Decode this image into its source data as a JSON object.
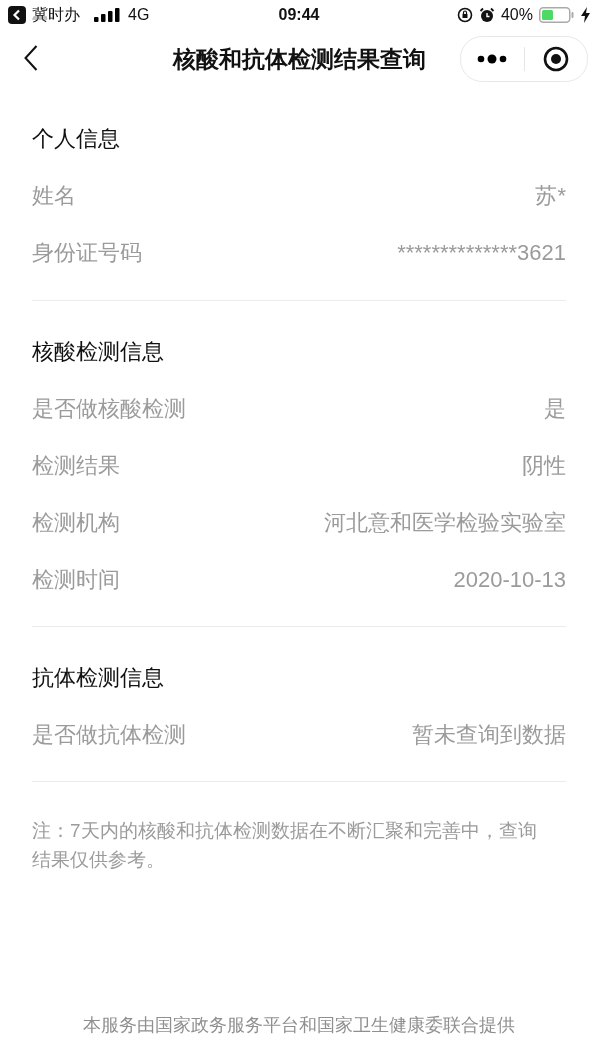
{
  "status_bar": {
    "back_app": "冀时办",
    "network": "4G",
    "time": "09:44",
    "battery": "40%"
  },
  "nav": {
    "title": "核酸和抗体检测结果查询"
  },
  "sections": [
    {
      "title": "个人信息",
      "rows": [
        {
          "label": "姓名",
          "value": "苏*"
        },
        {
          "label": "身份证号码",
          "value": "**************3621"
        }
      ]
    },
    {
      "title": "核酸检测信息",
      "rows": [
        {
          "label": "是否做核酸检测",
          "value": "是"
        },
        {
          "label": "检测结果",
          "value": "阴性"
        },
        {
          "label": "检测机构",
          "value": "河北意和医学检验实验室"
        },
        {
          "label": "检测时间",
          "value": "2020-10-13"
        }
      ]
    },
    {
      "title": "抗体检测信息",
      "rows": [
        {
          "label": "是否做抗体检测",
          "value": "暂未查询到数据"
        }
      ]
    }
  ],
  "note": "注：7天内的核酸和抗体检测数据在不断汇聚和完善中，查询结果仅供参考。",
  "footer": "本服务由国家政务服务平台和国家卫生健康委联合提供"
}
